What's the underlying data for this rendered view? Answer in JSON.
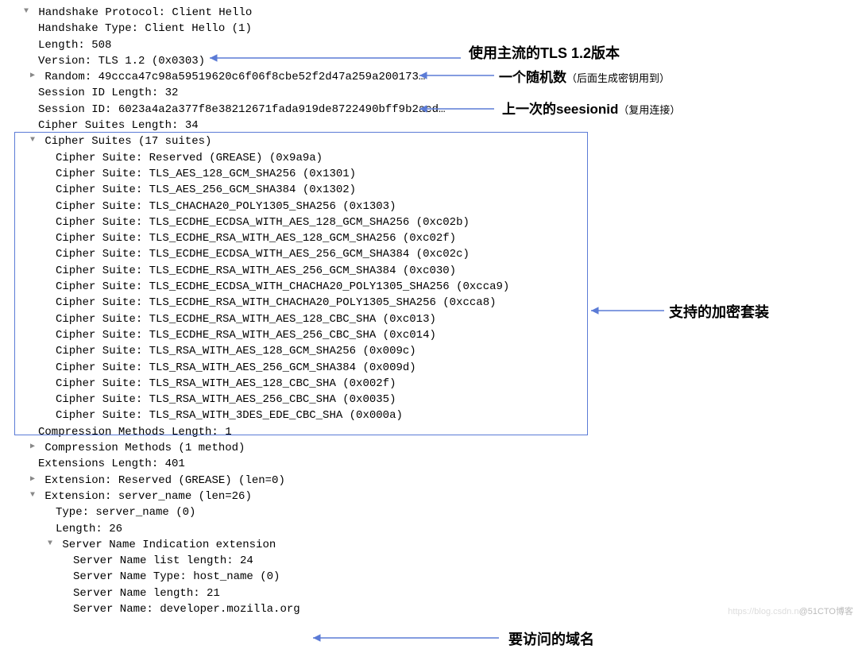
{
  "annotations": {
    "tls_version": "使用主流的TLS 1.2版本",
    "random": "一个随机数",
    "random_sub": "（后面生成密钥用到）",
    "session": "上一次的seesionid",
    "session_sub": "（复用连接）",
    "ciphers": "支持的加密套装",
    "hostname": "要访问的域名"
  },
  "watermark_left": "https://blog.csdn.n",
  "watermark_right": "@51CTO博客",
  "tree": {
    "proto_header": "Handshake Protocol: Client Hello",
    "handshake_type": "Handshake Type: Client Hello (1)",
    "length": "Length: 508",
    "version": "Version: TLS 1.2 (0x0303)",
    "random": "Random: 49ccca47c98a59519620c6f06f8cbe52f2d47a259a200173…",
    "sid_len": "Session ID Length: 32",
    "sid": "Session ID: 6023a4a2a377f8e38212671fada919de8722490bff9b2acd…",
    "cs_len": "Cipher Suites Length: 34",
    "cs_header": "Cipher Suites (17 suites)",
    "suites": [
      "Cipher Suite: Reserved (GREASE) (0x9a9a)",
      "Cipher Suite: TLS_AES_128_GCM_SHA256 (0x1301)",
      "Cipher Suite: TLS_AES_256_GCM_SHA384 (0x1302)",
      "Cipher Suite: TLS_CHACHA20_POLY1305_SHA256 (0x1303)",
      "Cipher Suite: TLS_ECDHE_ECDSA_WITH_AES_128_GCM_SHA256 (0xc02b)",
      "Cipher Suite: TLS_ECDHE_RSA_WITH_AES_128_GCM_SHA256 (0xc02f)",
      "Cipher Suite: TLS_ECDHE_ECDSA_WITH_AES_256_GCM_SHA384 (0xc02c)",
      "Cipher Suite: TLS_ECDHE_RSA_WITH_AES_256_GCM_SHA384 (0xc030)",
      "Cipher Suite: TLS_ECDHE_ECDSA_WITH_CHACHA20_POLY1305_SHA256 (0xcca9)",
      "Cipher Suite: TLS_ECDHE_RSA_WITH_CHACHA20_POLY1305_SHA256 (0xcca8)",
      "Cipher Suite: TLS_ECDHE_RSA_WITH_AES_128_CBC_SHA (0xc013)",
      "Cipher Suite: TLS_ECDHE_RSA_WITH_AES_256_CBC_SHA (0xc014)",
      "Cipher Suite: TLS_RSA_WITH_AES_128_GCM_SHA256 (0x009c)",
      "Cipher Suite: TLS_RSA_WITH_AES_256_GCM_SHA384 (0x009d)",
      "Cipher Suite: TLS_RSA_WITH_AES_128_CBC_SHA (0x002f)",
      "Cipher Suite: TLS_RSA_WITH_AES_256_CBC_SHA (0x0035)",
      "Cipher Suite: TLS_RSA_WITH_3DES_EDE_CBC_SHA (0x000a)"
    ],
    "cm_len": "Compression Methods Length: 1",
    "cm_header": "Compression Methods (1 method)",
    "ext_len": "Extensions Length: 401",
    "ext_grease": "Extension: Reserved (GREASE) (len=0)",
    "ext_sni": "Extension: server_name (len=26)",
    "sni_type": "Type: server_name (0)",
    "sni_len": "Length: 26",
    "sni_ext_header": "Server Name Indication extension",
    "sni_list_len": "Server Name list length: 24",
    "sni_name_type": "Server Name Type: host_name (0)",
    "sni_name_len": "Server Name length: 21",
    "sni_name": "Server Name: developer.mozilla.org"
  }
}
